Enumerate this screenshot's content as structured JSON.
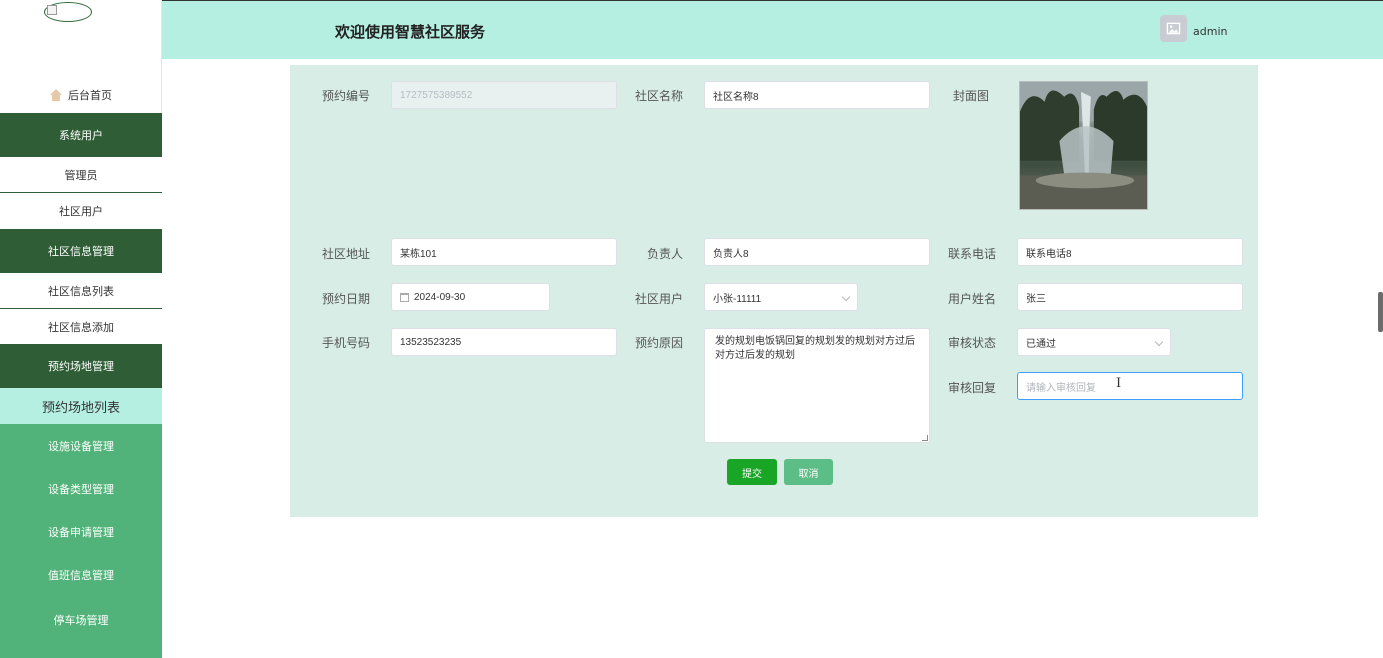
{
  "header": {
    "title": "欢迎使用智慧社区服务",
    "username": "admin"
  },
  "sidebar": {
    "home": "后台首页",
    "groups": [
      {
        "label": "系统用户",
        "items": [
          "管理员",
          "社区用户"
        ]
      },
      {
        "label": "社区信息管理",
        "items": [
          "社区信息列表",
          "社区信息添加"
        ]
      },
      {
        "label": "预约场地管理",
        "items": [
          "预约场地列表"
        ]
      }
    ],
    "more": [
      "设施设备管理",
      "设备类型管理",
      "设备申请管理",
      "值班信息管理",
      "停车场管理"
    ]
  },
  "form": {
    "booking_no": {
      "label": "预约编号",
      "value": "1727575389552"
    },
    "community_name": {
      "label": "社区名称",
      "value": "社区名称8"
    },
    "cover": {
      "label": "封面图"
    },
    "address": {
      "label": "社区地址",
      "value": "某栋101"
    },
    "manager": {
      "label": "负责人",
      "value": "负责人8"
    },
    "phone": {
      "label": "联系电话",
      "value": "联系电话8"
    },
    "date": {
      "label": "预约日期",
      "value": "2024-09-30"
    },
    "user": {
      "label": "社区用户",
      "value": "小张-11111"
    },
    "user_name": {
      "label": "用户姓名",
      "value": "张三"
    },
    "mobile": {
      "label": "手机号码",
      "value": "13523523235"
    },
    "reason": {
      "label": "预约原因",
      "value": "发的规划电饭锅回复的规划发的规划对方过后对方过后发的规划"
    },
    "status": {
      "label": "审核状态",
      "value": "已通过"
    },
    "reply": {
      "label": "审核回复",
      "placeholder": "请输入审核回复"
    },
    "submit": "提交",
    "cancel": "取消"
  }
}
